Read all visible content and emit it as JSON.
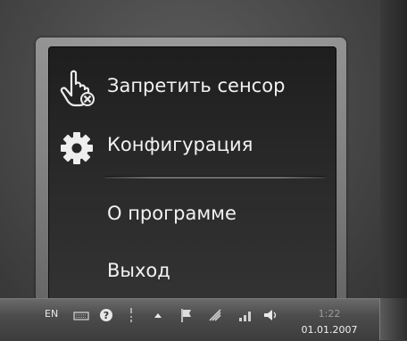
{
  "menu": {
    "items": [
      {
        "label": "Запретить сенсор",
        "icon": "touch-disable-icon"
      },
      {
        "label": "Конфигурация",
        "icon": "gear-icon"
      },
      {
        "label": "О программе",
        "icon": ""
      },
      {
        "label": "Выход",
        "icon": ""
      }
    ]
  },
  "taskbar": {
    "language": "EN",
    "tray_icons": [
      "keyboard-icon",
      "help-icon",
      "pen-icon",
      "show-hidden-icons-icon",
      "flag-icon",
      "network-icon",
      "signal-icon",
      "volume-icon"
    ],
    "clock_time": "1:22",
    "clock_date": "01.01.2007"
  }
}
